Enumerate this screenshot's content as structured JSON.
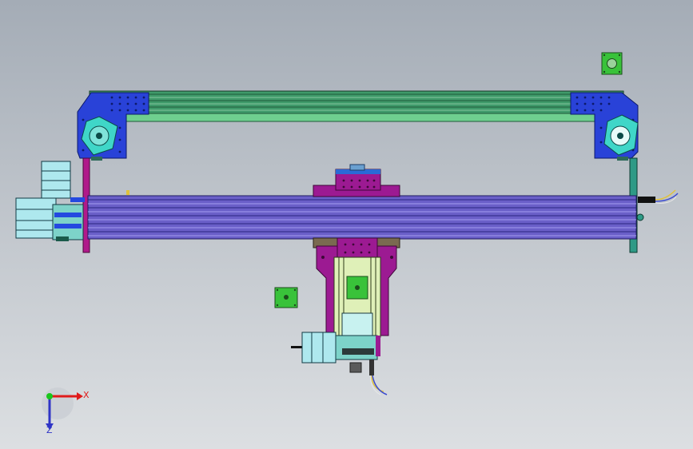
{
  "viewport": {
    "background_top": "#a4acb6",
    "background_bottom": "#dcdfe2"
  },
  "colors": {
    "bracket_blue": "#2942d8",
    "motor_cyan": "#3fd6c8",
    "rail_green": "#3f9a6a",
    "beam_purple": "#6a5fc8",
    "carriage_magenta": "#9c1a92",
    "plate_green": "#39c23a",
    "motor_body": "#aee8ee",
    "stand_green": "#2e9a86"
  },
  "triad": {
    "x_label": "X",
    "z_label": "Z",
    "x_color": "#e01b1b",
    "y_color": "#19c61b",
    "z_color": "#2f34c6"
  }
}
